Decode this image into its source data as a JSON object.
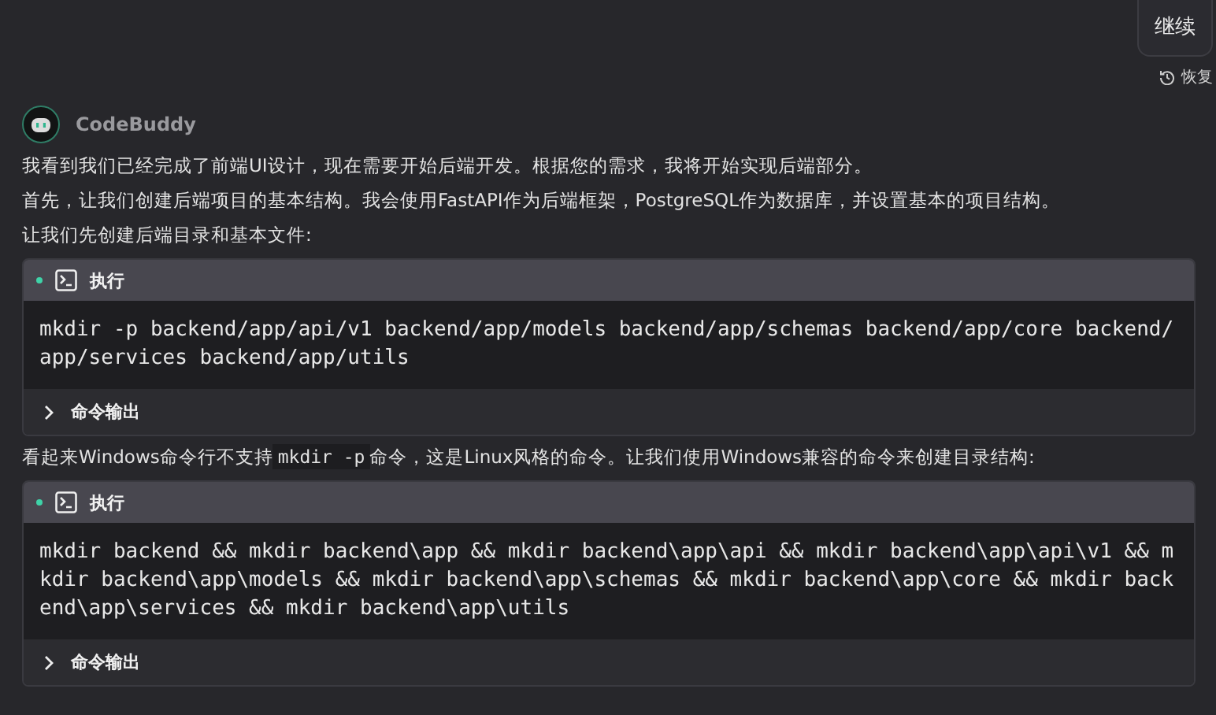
{
  "continue_button": "继续",
  "restore_link": "恢复",
  "message": {
    "author": "CodeBuddy",
    "blocks": [
      {
        "kind": "paragraph",
        "parts": [
          {
            "kind": "text",
            "text": "我看到我们已经完成了前端UI设计，现在需要开始后端开发。根据您的需求，我将开始实现后端部分。"
          }
        ]
      },
      {
        "kind": "paragraph",
        "parts": [
          {
            "kind": "text",
            "text": "首先，让我们创建后端项目的基本结构。我会使用FastAPI作为后端框架，PostgreSQL作为数据库，并设置基本的项目结构。"
          }
        ]
      },
      {
        "kind": "paragraph",
        "parts": [
          {
            "kind": "text",
            "text": "让我们先创建后端目录和基本文件:"
          }
        ]
      },
      {
        "kind": "command",
        "title": "执行",
        "command": "mkdir -p backend/app/api/v1 backend/app/models backend/app/schemas backend/app/core backend/app/services backend/app/utils",
        "output_label": "命令输出",
        "output_expanded": false
      },
      {
        "kind": "paragraph",
        "parts": [
          {
            "kind": "text",
            "text": "看起来Windows命令行不支持"
          },
          {
            "kind": "code",
            "text": "mkdir -p"
          },
          {
            "kind": "text",
            "text": "命令，这是Linux风格的命令。让我们使用Windows兼容的命令来创建目录结构:"
          }
        ]
      },
      {
        "kind": "command",
        "title": "执行",
        "command": "mkdir backend && mkdir backend\\app && mkdir backend\\app\\api && mkdir backend\\app\\api\\v1 && mkdir backend\\app\\models && mkdir backend\\app\\schemas && mkdir backend\\app\\core && mkdir backend\\app\\services && mkdir backend\\app\\utils",
        "output_label": "命令输出",
        "output_expanded": false
      }
    ]
  }
}
